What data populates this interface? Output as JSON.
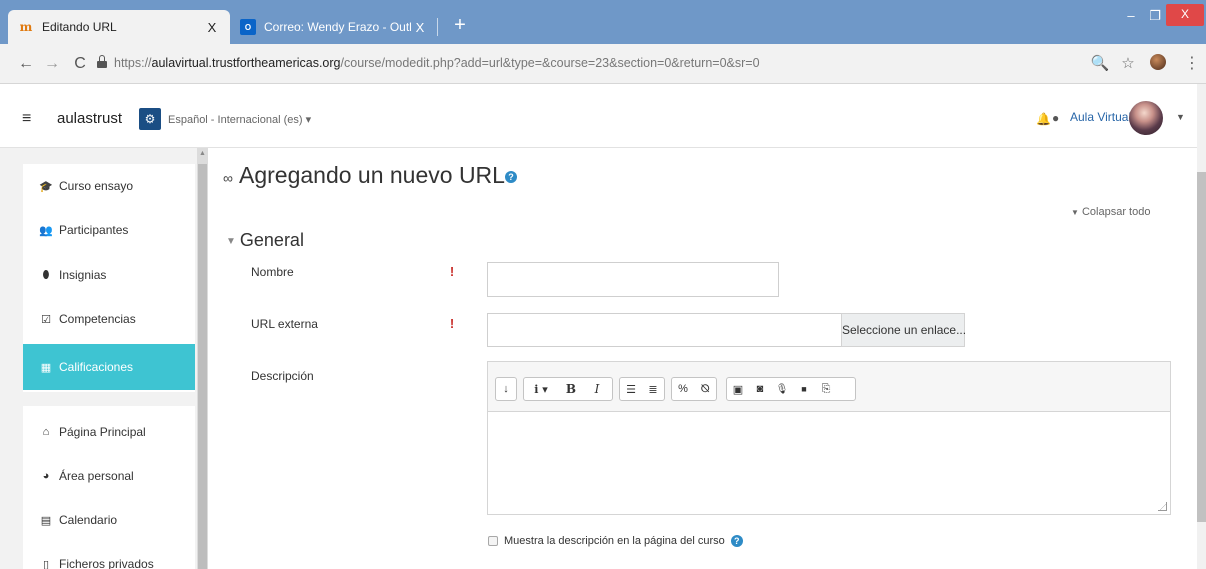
{
  "browser": {
    "tabs": [
      {
        "favicon": "moodle-icon",
        "glyph": "m",
        "label": "Editando URL",
        "close": "X",
        "active": true
      },
      {
        "favicon": "outlook-icon",
        "glyph": "O",
        "label": "Correo: Wendy Erazo - Outlook",
        "close": "X",
        "active": false
      }
    ],
    "new_tab": "+",
    "window": {
      "minimize": "–",
      "maximize": "❐",
      "close": "X"
    },
    "nav": {
      "back": "←",
      "forward": "→",
      "reload": "C"
    },
    "url": {
      "scheme": "https://",
      "host": "aulavirtual.trustfortheamericas.org",
      "path": "/course/modedit.php?add=url&type=&course=23&section=0&return=0&sr=0"
    },
    "icons": {
      "zoom": "🔍",
      "bookmark": "☆",
      "menu": "⋮"
    }
  },
  "moodle": {
    "menu_toggle": "≡",
    "site_name": "aulastrust",
    "admin_gear": "⚙",
    "language": "Español - Internacional (es) ▾",
    "notifications": "🔔",
    "messages": "●",
    "user_name": "Aula Virtual",
    "user_caret": "▼"
  },
  "drawer": {
    "group1": [
      {
        "icon": "graduation-cap-icon",
        "glyph": "🎓",
        "label": "Curso ensayo"
      },
      {
        "icon": "users-icon",
        "glyph": "👥",
        "label": "Participantes"
      },
      {
        "icon": "badge-icon",
        "glyph": "⬮",
        "label": "Insignias"
      },
      {
        "icon": "check-square-icon",
        "glyph": "☑",
        "label": "Competencias"
      },
      {
        "icon": "table-icon",
        "glyph": "▦",
        "label": "Calificaciones",
        "active": true
      }
    ],
    "group2": [
      {
        "icon": "home-icon",
        "glyph": "⌂",
        "label": "Página Principal"
      },
      {
        "icon": "dashboard-icon",
        "glyph": "◕",
        "label": "Área personal"
      },
      {
        "icon": "calendar-icon",
        "glyph": "▤",
        "label": "Calendario"
      },
      {
        "icon": "file-icon",
        "glyph": "▯",
        "label": "Ficheros privados"
      }
    ]
  },
  "page": {
    "title_icon": "∞",
    "title": "Agregando un nuevo URL",
    "title_help": "?",
    "collapse_all": "Colapsar todo",
    "collapse_tri": "▼",
    "section_tri": "▼",
    "section": "General"
  },
  "form": {
    "name_label": "Nombre",
    "name_value": "",
    "name_required": "!",
    "url_label": "URL externa",
    "url_value": "",
    "url_required": "!",
    "choose_link": "Seleccione un enlace...",
    "description_label": "Descripción",
    "description_value": "",
    "editor_toolbar": {
      "expand": "↓",
      "para_style": "i ▾",
      "bold": "B",
      "italic": "I",
      "bullets": "☰",
      "numbered": "≣",
      "link": "%",
      "unlink": "⦰",
      "image": "▣",
      "media": "◙",
      "record_audio": "🎙",
      "record_video": "■",
      "manage_files": "⎘"
    },
    "show_description_label": "Muestra la descripción en la página del curso",
    "show_description_checked": false,
    "show_description_help": "?"
  }
}
